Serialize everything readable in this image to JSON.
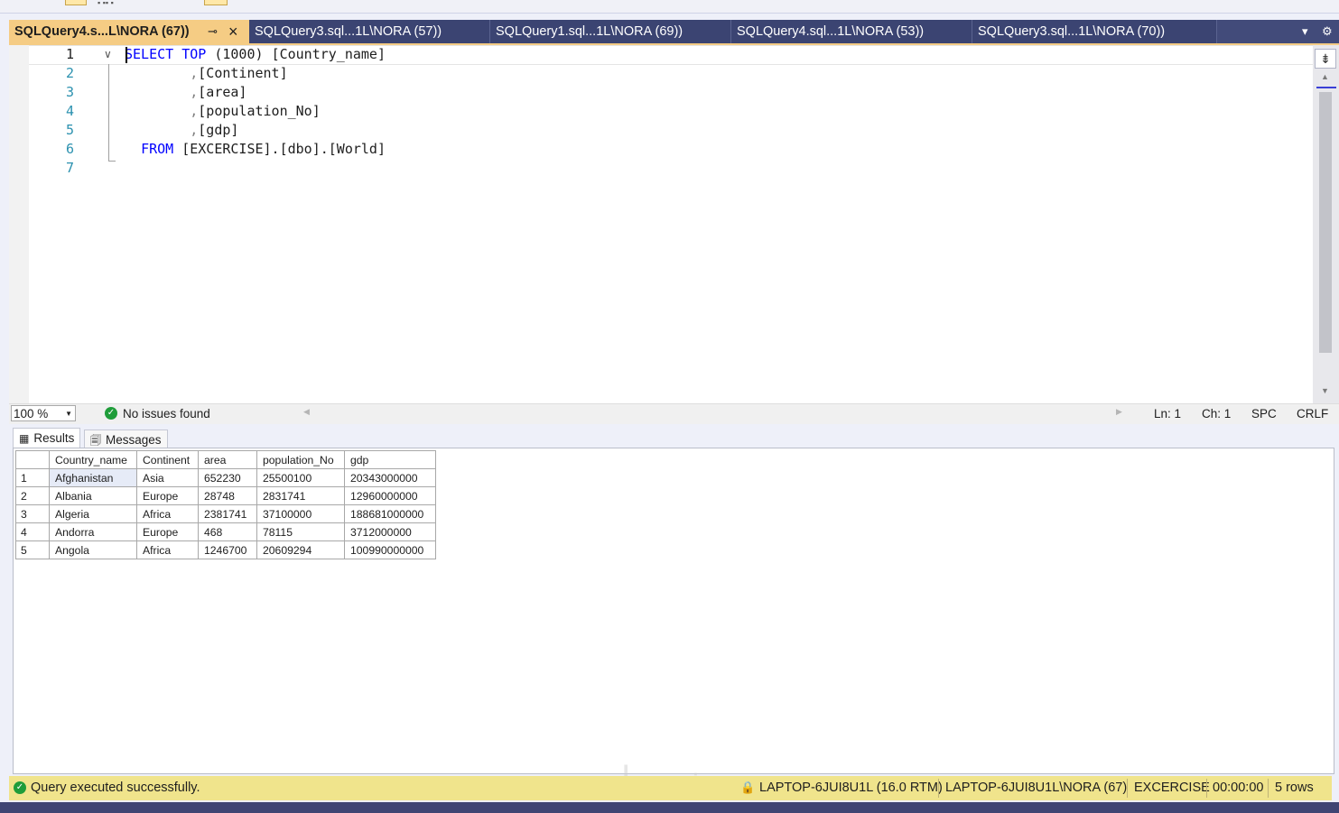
{
  "tabs": [
    {
      "label": "SQLQuery4.s...L\\NORA (67))",
      "active": true
    },
    {
      "label": "SQLQuery3.sql...1L\\NORA (57))",
      "active": false
    },
    {
      "label": "SQLQuery1.sql...1L\\NORA (69))",
      "active": false
    },
    {
      "label": "SQLQuery4.sql...1L\\NORA (53))",
      "active": false
    },
    {
      "label": "SQLQuery3.sql...1L\\NORA (70))",
      "active": false
    }
  ],
  "editor": {
    "line_numbers": [
      "1",
      "2",
      "3",
      "4",
      "5",
      "6",
      "7"
    ],
    "lines": [
      {
        "kw1": "SELECT",
        "kw2": "TOP",
        "rest1": " (1000) ",
        "rest2": "[Country_name]"
      },
      {
        "comma": ",",
        "text": "[Continent]"
      },
      {
        "comma": ",",
        "text": "[area]"
      },
      {
        "comma": ",",
        "text": "[population_No]"
      },
      {
        "comma": ",",
        "text": "[gdp]"
      },
      {
        "kw": "FROM",
        "text": " [EXCERCISE].[dbo].[World]"
      },
      {
        "text": ""
      }
    ]
  },
  "status_strip": {
    "zoom": "100 %",
    "issues": "No issues found",
    "ln": "Ln: 1",
    "ch": "Ch: 1",
    "spc": "SPC",
    "crlf": "CRLF"
  },
  "result_tabs": {
    "results": "Results",
    "messages": "Messages"
  },
  "results_table": {
    "columns": [
      "Country_name",
      "Continent",
      "area",
      "population_No",
      "gdp"
    ],
    "rows": [
      {
        "n": "1",
        "cells": [
          "Afghanistan",
          "Asia",
          "652230",
          "25500100",
          "20343000000"
        ]
      },
      {
        "n": "2",
        "cells": [
          "Albania",
          "Europe",
          "28748",
          "2831741",
          "12960000000"
        ]
      },
      {
        "n": "3",
        "cells": [
          "Algeria",
          "Africa",
          "2381741",
          "37100000",
          "188681000000"
        ]
      },
      {
        "n": "4",
        "cells": [
          "Andorra",
          "Europe",
          "468",
          "78115",
          "3712000000"
        ]
      },
      {
        "n": "5",
        "cells": [
          "Angola",
          "Africa",
          "1246700",
          "20609294",
          "100990000000"
        ]
      }
    ]
  },
  "query_status": {
    "message": "Query executed successfully.",
    "server": "LAPTOP-6JUI8U1L (16.0 RTM)",
    "login": "LAPTOP-6JUI8U1L\\NORA (67)",
    "database": "EXCERCISE",
    "elapsed": "00:00:00",
    "rows": "5 rows"
  },
  "colors": {
    "tab_bar": "#424b7a",
    "active_tab": "#f5cc84",
    "keyword": "#0000ff",
    "status_bar": "#f0e48c",
    "ok_green": "#1f9d3a"
  },
  "icons": [
    "pin-icon",
    "close-icon",
    "tab-dropdown-icon",
    "settings-gear-icon",
    "fold-collapse-icon",
    "split-icon",
    "ok-check-icon",
    "grid-icon",
    "messages-icon",
    "lock-icon"
  ]
}
